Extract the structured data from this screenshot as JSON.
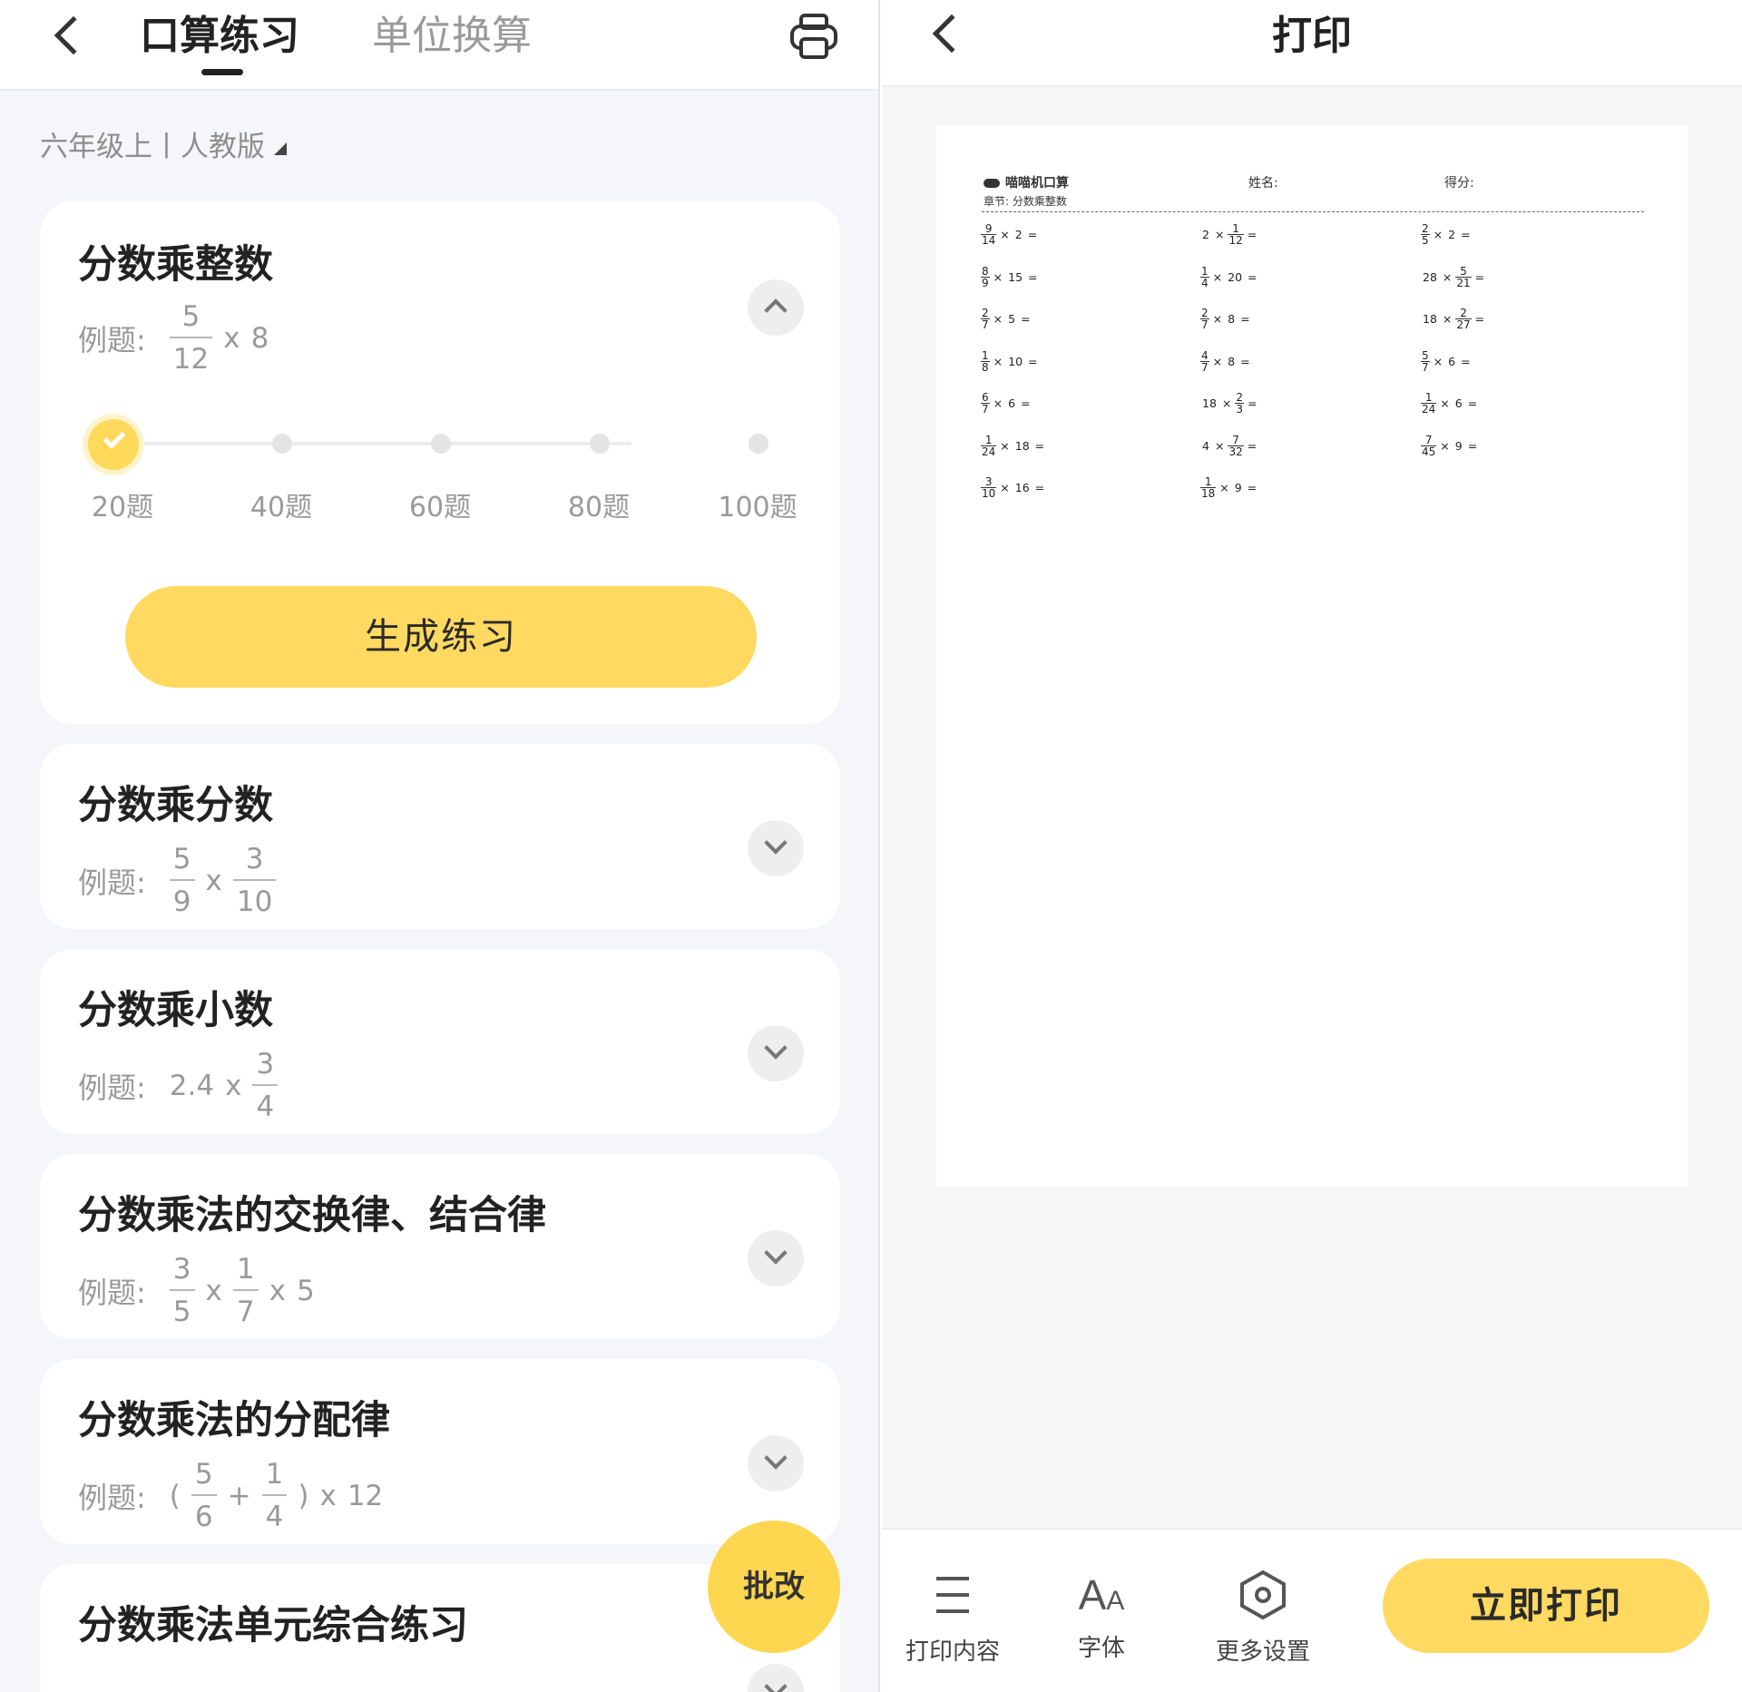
{
  "left": {
    "tabs": [
      {
        "label": "口算练习",
        "active": true
      },
      {
        "label": "单位换算",
        "active": false
      }
    ],
    "grade": "六年级上丨人教版",
    "slider": {
      "options": [
        "20题",
        "40题",
        "60题",
        "80题",
        "100题"
      ],
      "selected": "20题"
    },
    "example_label": "例题:",
    "generate_button": "生成练习",
    "fab_label": "批改",
    "cards": [
      {
        "title": "分数乘整数",
        "expanded": true,
        "ex": {
          "n1": "5",
          "d1": "12",
          "op": "x",
          "t": "8"
        }
      },
      {
        "title": "分数乘分数",
        "ex": {
          "n1": "5",
          "d1": "9",
          "op": "x",
          "n2": "3",
          "d2": "10"
        }
      },
      {
        "title": "分数乘小数",
        "ex": {
          "pre": "2.4",
          "op": "x",
          "n1": "3",
          "d1": "4"
        }
      },
      {
        "title": "分数乘法的交换律、结合律",
        "ex": {
          "n1": "3",
          "d1": "5",
          "op": "x",
          "n2": "1",
          "d2": "7",
          "op2": "x",
          "t": "5"
        }
      },
      {
        "title": "分数乘法的分配律",
        "ex": {
          "lp": "(",
          "n1": "5",
          "d1": "6",
          "op": "+",
          "n2": "1",
          "d2": "4",
          "rp": ")",
          "op2": "x",
          "t": "12"
        }
      },
      {
        "title": "分数乘法单元综合练习"
      }
    ]
  },
  "right": {
    "title": "打印",
    "paper": {
      "app_name": "喵喵机口算",
      "name_label": "姓名:",
      "score_label": "得分:",
      "chapter": "章节: 分数乘整数",
      "questions": [
        [
          "9/14 × 2 =",
          "2 × 1/12 =",
          "2/5 × 2 ="
        ],
        [
          "8/9 × 15 =",
          "1/4 × 20 =",
          "28 × 5/21 ="
        ],
        [
          "2/7 × 5 =",
          "2/7 × 8 =",
          "18 × 2/27 ="
        ],
        [
          "1/8 × 10 =",
          "4/7 × 8 =",
          "5/7 × 6 ="
        ],
        [
          "6/7 × 6 =",
          "18 × 2/3 =",
          "1/24 × 6 ="
        ],
        [
          "1/24 × 18 =",
          "4 × 7/32 =",
          "7/45 × 9 ="
        ],
        [
          "3/10 × 16 =",
          "1/18 × 9 ="
        ]
      ]
    },
    "footer": {
      "tools": [
        {
          "label": "打印内容",
          "icon": "list-icon"
        },
        {
          "label": "字体",
          "icon": "font-icon"
        },
        {
          "label": "更多设置",
          "icon": "settings-icon"
        }
      ],
      "print_button": "立即打印"
    }
  }
}
